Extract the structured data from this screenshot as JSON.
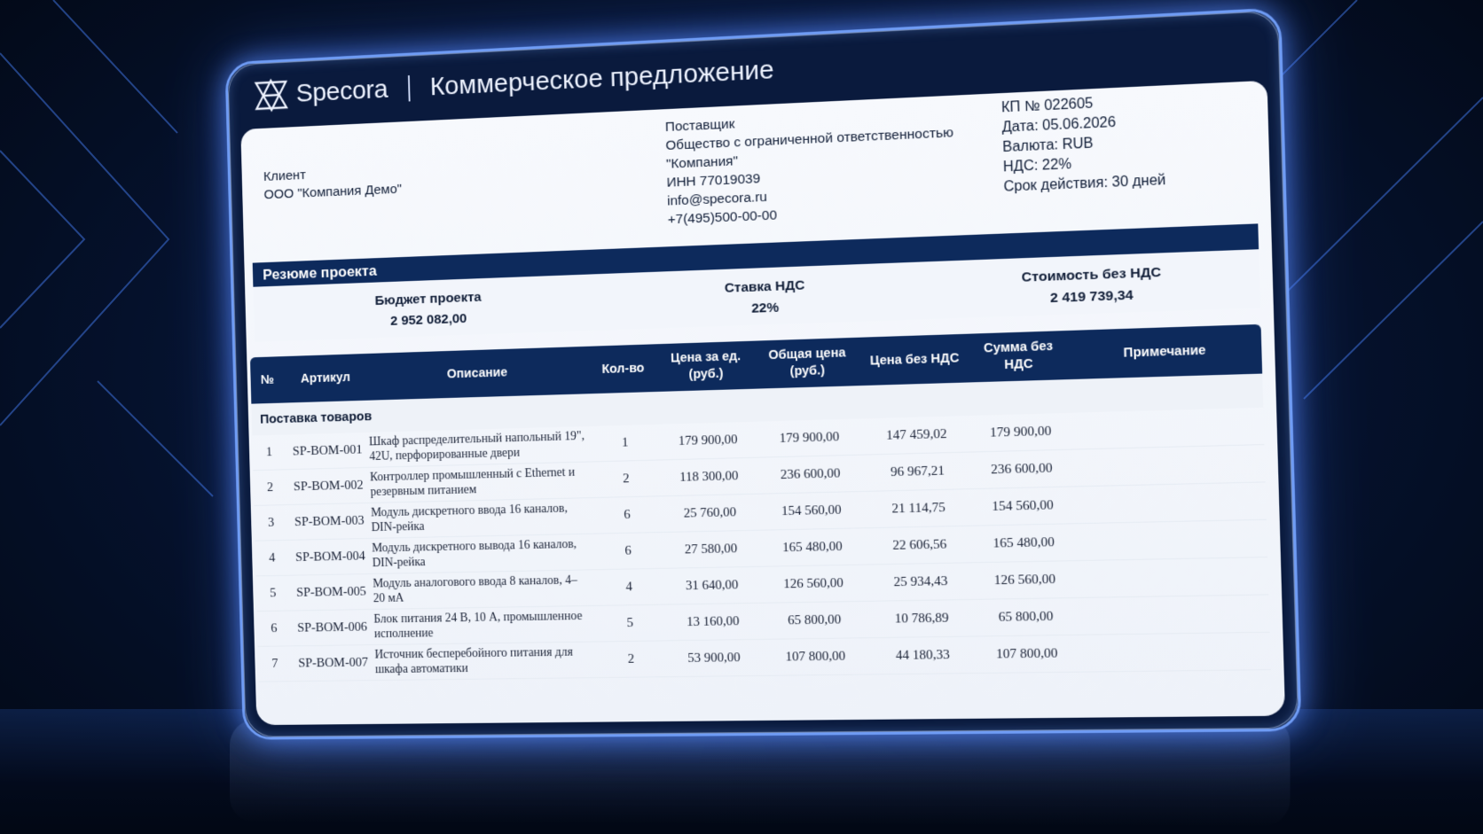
{
  "brand": {
    "name": "Specora",
    "logo_icon": "specora-logo-icon"
  },
  "document": {
    "title": "Коммерческое предложение"
  },
  "client": {
    "label": "Клиент",
    "name": "ООО \"Компания Демо\""
  },
  "supplier": {
    "label": "Поставщик",
    "name_line1": "Общество с ограниченной ответственностью",
    "name_line2": "\"Компания\"",
    "inn": "ИНН 77019039",
    "email": "info@specora.ru",
    "phone": "+7(495)500-00-00"
  },
  "meta": {
    "number": "КП № 022605",
    "date": "Дата: 05.06.2026",
    "currency": "Валюта: RUB",
    "vat": "НДС: 22%",
    "validity": "Срок действия: 30 дней"
  },
  "summary": {
    "section_title": "Резюме проекта",
    "budget_label": "Бюджет проекта",
    "budget_value": "2 952 082,00",
    "vat_label": "Ставка НДС",
    "vat_value": "22%",
    "net_label": "Стоимость без НДС",
    "net_value": "2 419 739,34"
  },
  "table": {
    "headers": {
      "num": "№",
      "sku": "Артикул",
      "desc": "Описание",
      "qty": "Кол-во",
      "unit_price": "Цена за ед. (руб.)",
      "total_price": "Общая цена (руб.)",
      "price_no_vat": "Цена без НДС",
      "sum_no_vat": "Сумма без НДС",
      "note": "Примечание"
    },
    "group": "Поставка товаров",
    "rows": [
      {
        "num": "1",
        "sku": "SP-BOM-001",
        "desc": "Шкаф распределительный напольный 19\", 42U, перфорированные двери",
        "qty": "1",
        "unit": "179 900,00",
        "total": "179 900,00",
        "net": "147 459,02",
        "sum": "179 900,00",
        "note": ""
      },
      {
        "num": "2",
        "sku": "SP-BOM-002",
        "desc": "Контроллер промышленный с Ethernet и резервным питанием",
        "qty": "2",
        "unit": "118 300,00",
        "total": "236 600,00",
        "net": "96 967,21",
        "sum": "236 600,00",
        "note": ""
      },
      {
        "num": "3",
        "sku": "SP-BOM-003",
        "desc": "Модуль дискретного ввода 16 каналов, DIN-рейка",
        "qty": "6",
        "unit": "25 760,00",
        "total": "154 560,00",
        "net": "21 114,75",
        "sum": "154 560,00",
        "note": ""
      },
      {
        "num": "4",
        "sku": "SP-BOM-004",
        "desc": "Модуль дискретного вывода 16 каналов, DIN-рейка",
        "qty": "6",
        "unit": "27 580,00",
        "total": "165 480,00",
        "net": "22 606,56",
        "sum": "165 480,00",
        "note": ""
      },
      {
        "num": "5",
        "sku": "SP-BOM-005",
        "desc": "Модуль аналогового ввода 8 каналов, 4–20 мА",
        "qty": "4",
        "unit": "31 640,00",
        "total": "126 560,00",
        "net": "25 934,43",
        "sum": "126 560,00",
        "note": ""
      },
      {
        "num": "6",
        "sku": "SP-BOM-006",
        "desc": "Блок питания 24 В, 10 А, промышленное исполнение",
        "qty": "5",
        "unit": "13 160,00",
        "total": "65 800,00",
        "net": "10 786,89",
        "sum": "65 800,00",
        "note": ""
      },
      {
        "num": "7",
        "sku": "SP-BOM-007",
        "desc": "Источник бесперебойного питания для шкафа автоматики",
        "qty": "2",
        "unit": "53 900,00",
        "total": "107 800,00",
        "net": "44 180,33",
        "sum": "107 800,00",
        "note": ""
      }
    ]
  },
  "colors": {
    "accent": "#0d2a5c",
    "glow": "#6f9cf5",
    "background": "#061433"
  }
}
